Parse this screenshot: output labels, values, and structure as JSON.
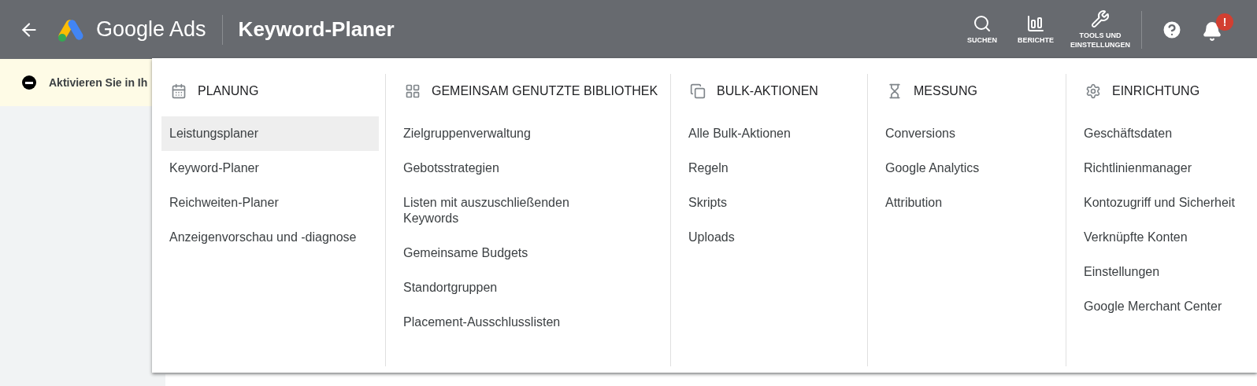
{
  "header": {
    "brand": "Google Ads",
    "page_title": "Keyword-Planer",
    "tools": [
      {
        "label": "SUCHEN"
      },
      {
        "label": "BERICHTE"
      },
      {
        "label": "TOOLS UND EINSTELLUNGEN"
      }
    ],
    "notification_badge": "!"
  },
  "banner": {
    "text": "Aktivieren Sie in Ih"
  },
  "menu": {
    "columns": [
      {
        "heading": "PLANUNG",
        "items": [
          {
            "label": "Leistungsplaner",
            "selected": true
          },
          {
            "label": "Keyword-Planer",
            "selected": false
          },
          {
            "label": "Reichweiten-Planer",
            "selected": false
          },
          {
            "label": "Anzeigenvorschau und -diagnose",
            "selected": false
          }
        ]
      },
      {
        "heading": "GEMEINSAM GENUTZTE BIBLIOTHEK",
        "items": [
          {
            "label": "Zielgruppenverwaltung",
            "selected": false
          },
          {
            "label": "Gebotsstrategien",
            "selected": false
          },
          {
            "label": "Listen mit auszuschließenden Keywords",
            "selected": false
          },
          {
            "label": "Gemeinsame Budgets",
            "selected": false
          },
          {
            "label": "Standortgruppen",
            "selected": false
          },
          {
            "label": "Placement-Ausschlusslisten",
            "selected": false
          }
        ]
      },
      {
        "heading": "BULK-AKTIONEN",
        "items": [
          {
            "label": "Alle Bulk-Aktionen",
            "selected": false
          },
          {
            "label": "Regeln",
            "selected": false
          },
          {
            "label": "Skripts",
            "selected": false
          },
          {
            "label": "Uploads",
            "selected": false
          }
        ]
      },
      {
        "heading": "MESSUNG",
        "items": [
          {
            "label": "Conversions",
            "selected": false
          },
          {
            "label": "Google Analytics",
            "selected": false
          },
          {
            "label": "Attribution",
            "selected": false
          }
        ]
      },
      {
        "heading": "EINRICHTUNG",
        "items": [
          {
            "label": "Geschäftsdaten",
            "selected": false
          },
          {
            "label": "Richtlinienmanager",
            "selected": false
          },
          {
            "label": "Kontozugriff und Sicherheit",
            "selected": false
          },
          {
            "label": "Verknüpfte Konten",
            "selected": false
          },
          {
            "label": "Einstellungen",
            "selected": false
          },
          {
            "label": "Google Merchant Center",
            "selected": false
          }
        ]
      }
    ]
  }
}
